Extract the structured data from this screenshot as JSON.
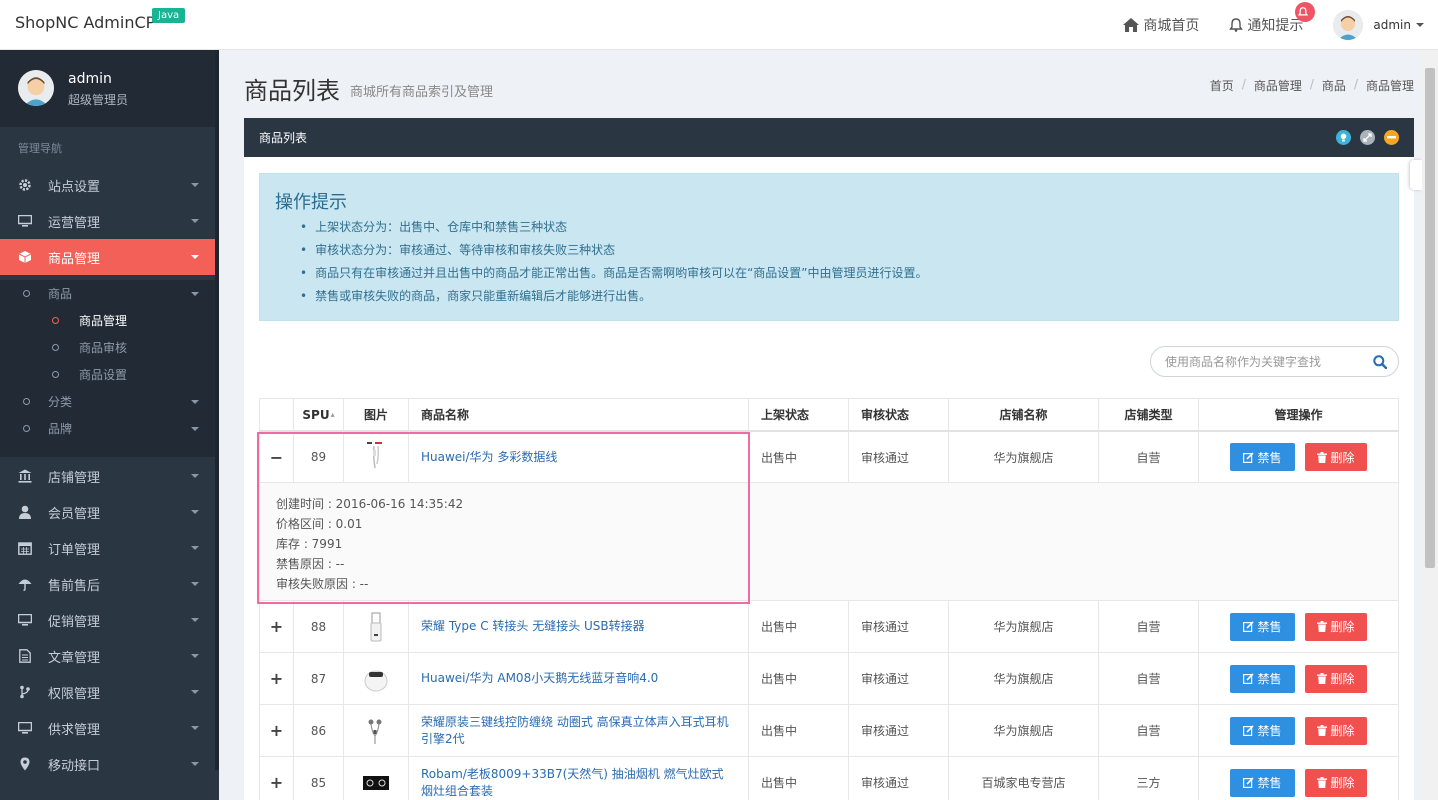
{
  "brand": {
    "name": "ShopNC AdminCP",
    "badge": "Java"
  },
  "topnav": {
    "home": "商城首页",
    "notice": "通知提示",
    "user": "admin"
  },
  "sidebar": {
    "username": "admin",
    "role": "超级管理员",
    "heading": "管理导航",
    "items": [
      {
        "label": "站点设置",
        "icon": "gear-icon"
      },
      {
        "label": "运营管理",
        "icon": "monitor-icon"
      },
      {
        "label": "商品管理",
        "icon": "cube-icon",
        "active": true
      },
      {
        "label": "店铺管理",
        "icon": "bank-icon"
      },
      {
        "label": "会员管理",
        "icon": "user-icon"
      },
      {
        "label": "订单管理",
        "icon": "calendar-icon"
      },
      {
        "label": "售前售后",
        "icon": "umbrella-icon"
      },
      {
        "label": "促销管理",
        "icon": "monitor-icon"
      },
      {
        "label": "文章管理",
        "icon": "file-icon"
      },
      {
        "label": "权限管理",
        "icon": "branch-icon"
      },
      {
        "label": "供求管理",
        "icon": "monitor-icon"
      },
      {
        "label": "移动接口",
        "icon": "map-marker-icon"
      }
    ],
    "sub": {
      "goods": "商品",
      "goods_manage": "商品管理",
      "goods_audit": "商品审核",
      "goods_settings": "商品设置",
      "category": "分类",
      "brand": "品牌"
    }
  },
  "page": {
    "title": "商品列表",
    "subtitle": "商城所有商品索引及管理",
    "breadcrumb": [
      "首页",
      "商品管理",
      "商品",
      "商品管理"
    ]
  },
  "panel": {
    "title": "商品列表"
  },
  "tips": {
    "title": "操作提示",
    "items": [
      "上架状态分为：出售中、仓库中和禁售三种状态",
      "审核状态分为：审核通过、等待审核和审核失败三种状态",
      "商品只有在审核通过并且出售中的商品才能正常出售。商品是否需啊哟审核可以在“商品设置”中由管理员进行设置。",
      "禁售或审核失败的商品，商家只能重新编辑后才能够进行出售。"
    ]
  },
  "search": {
    "placeholder": "使用商品名称作为关键字查找"
  },
  "table": {
    "headers": [
      "SPU",
      "图片",
      "商品名称",
      "上架状态",
      "审核状态",
      "店铺名称",
      "店铺类型",
      "管理操作"
    ],
    "ban_label": "禁售",
    "delete_label": "删除",
    "rows": [
      {
        "toggle": "−",
        "spu": "89",
        "name": "Huawei/华为 多彩数据线",
        "sale": "出售中",
        "audit": "审核通过",
        "shop": "华为旗舰店",
        "type": "自营"
      },
      {
        "toggle": "+",
        "spu": "88",
        "name": "荣耀 Type C 转接头 无缝接头 USB转接器",
        "sale": "出售中",
        "audit": "审核通过",
        "shop": "华为旗舰店",
        "type": "自营"
      },
      {
        "toggle": "+",
        "spu": "87",
        "name": "Huawei/华为 AM08小天鹅无线蓝牙音响4.0",
        "sale": "出售中",
        "audit": "审核通过",
        "shop": "华为旗舰店",
        "type": "自营"
      },
      {
        "toggle": "+",
        "spu": "86",
        "name": "荣耀原装三键线控防缠绕 动圈式 高保真立体声入耳式耳机引擎2代",
        "sale": "出售中",
        "audit": "审核通过",
        "shop": "华为旗舰店",
        "type": "自营"
      },
      {
        "toggle": "+",
        "spu": "85",
        "name": "Robam/老板8009+33B7(天然气) 抽油烟机 燃气灶欧式烟灶组合套装",
        "sale": "出售中",
        "audit": "审核通过",
        "shop": "百城家电专营店",
        "type": "三方"
      }
    ],
    "detail": {
      "created": "创建时间 : 2016-06-16 14:35:42",
      "price": "价格区间 : 0.01",
      "stock": "库存 : 7991",
      "ban_reason": "禁售原因 : --",
      "audit_fail_reason": "审核失败原因 : --"
    }
  },
  "colors": {
    "sidebar_bg": "#2b3643",
    "active": "#f26057",
    "ban_btn": "#2f8fe0",
    "del_btn": "#f0514f",
    "tips_bg": "#c9e6f1"
  }
}
